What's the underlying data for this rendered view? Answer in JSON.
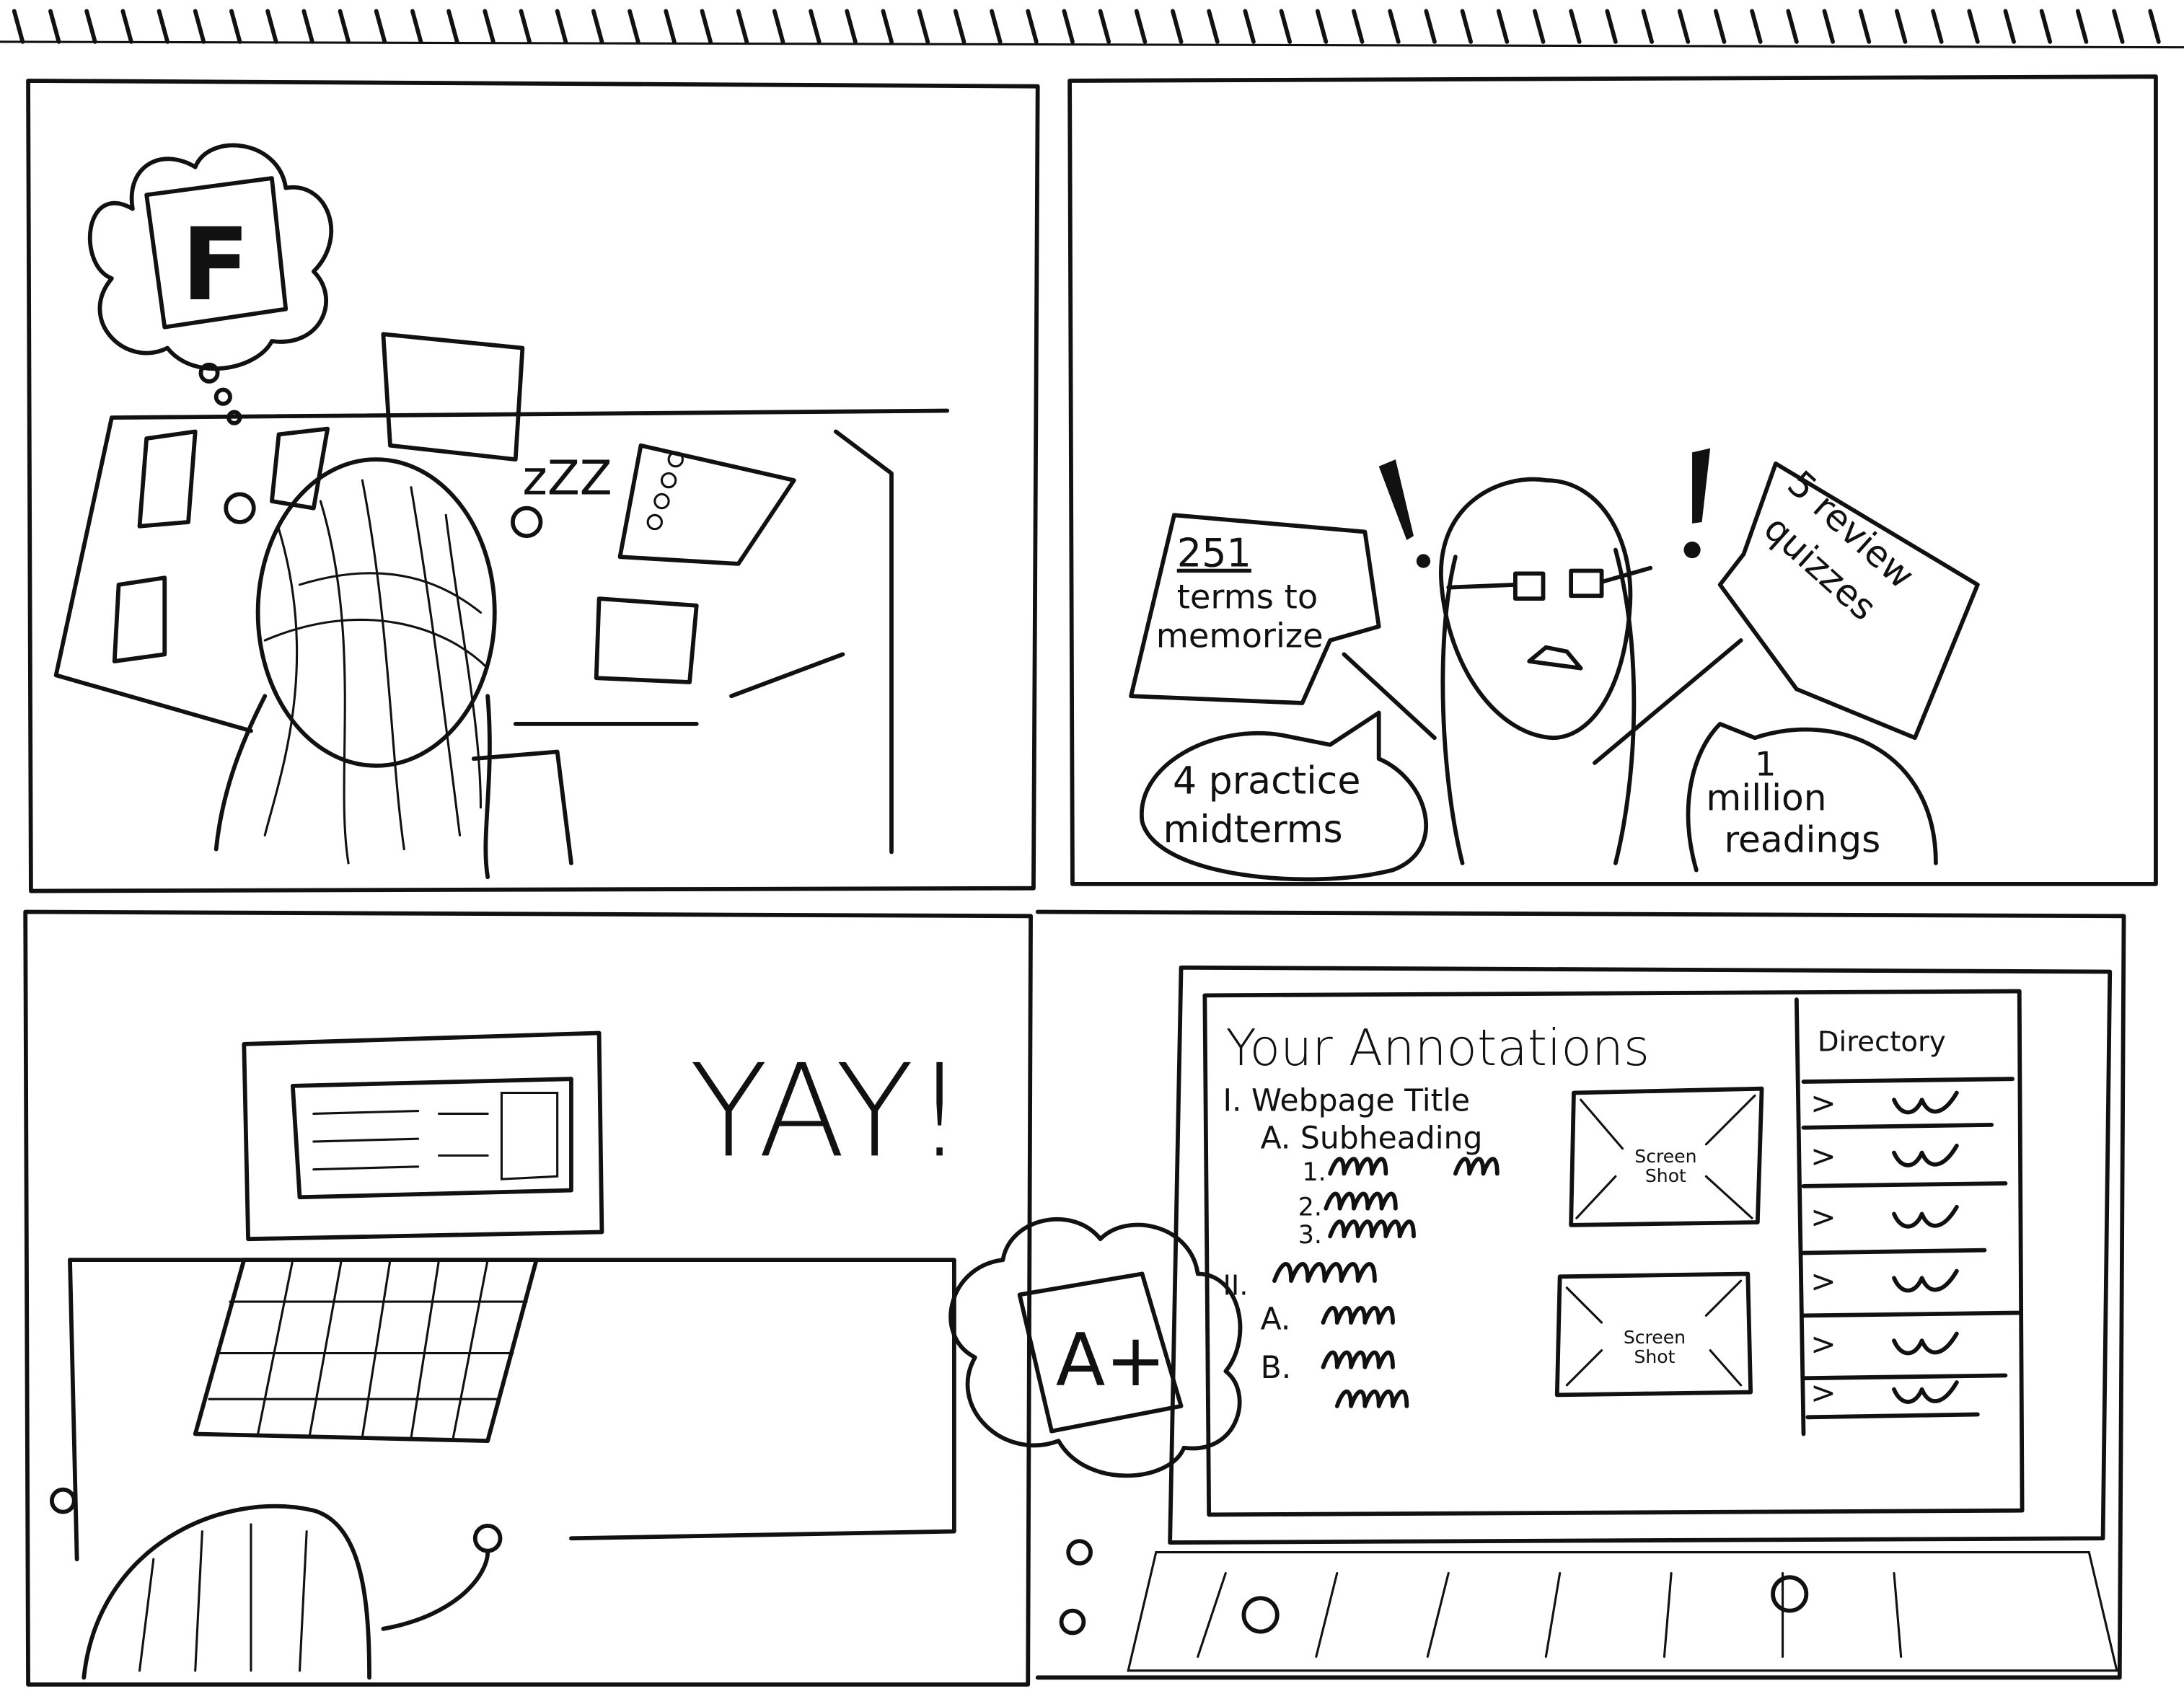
{
  "panel_1": {
    "thought_grade": "F",
    "sleep": "zZZ"
  },
  "panel_2": {
    "exclamations": [
      "!",
      "!"
    ],
    "bubble_terms": {
      "number": "251",
      "line1": "terms to",
      "line2": "memorize"
    },
    "bubble_midterms": {
      "line1": "4 practice",
      "line2": "midterms"
    },
    "bubble_quizzes": {
      "line1": "5 review",
      "line2": "quizzes"
    },
    "bubble_readings": {
      "number": "1",
      "line1": "million",
      "line2": "readings"
    }
  },
  "panel_3": {
    "exclaim": "YAY!"
  },
  "panel_4": {
    "thought_grade": "A+",
    "screen": {
      "title": "Your Annotations",
      "outline": [
        {
          "label": "I. Webpage Title"
        },
        {
          "label": "A. Subheading"
        },
        {
          "label": "1."
        },
        {
          "label": "2."
        },
        {
          "label": "3."
        },
        {
          "label": "II."
        },
        {
          "label": "A."
        },
        {
          "label": "B."
        }
      ],
      "screenshots": [
        "Screen Shot",
        "Screen Shot"
      ],
      "directory": {
        "title": "Directory",
        "items": [
          ">",
          ">",
          ">",
          ">",
          ">",
          ">"
        ]
      }
    }
  }
}
